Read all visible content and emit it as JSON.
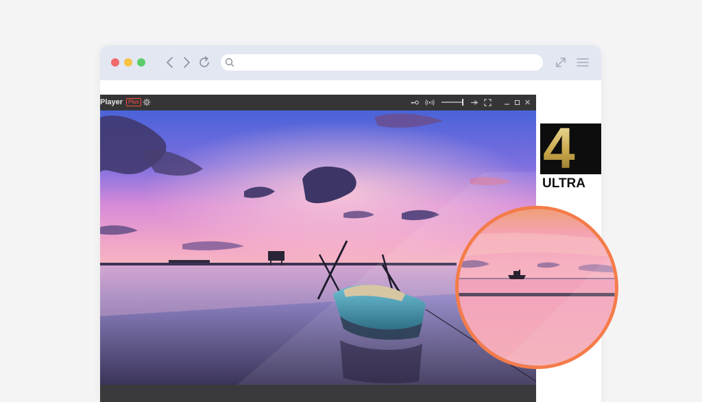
{
  "browser": {
    "window_controls": [
      "close",
      "minimize",
      "maximize"
    ],
    "nav_icons": [
      "back-icon",
      "forward-icon",
      "reload-icon"
    ],
    "search_icon": "search-icon",
    "address_value": "",
    "right_icons": [
      "expand-icon",
      "menu-icon"
    ]
  },
  "player": {
    "title": "Player",
    "badge": "Plus",
    "settings_icon": "gear-icon",
    "controls": [
      "key-icon",
      "broadcast-icon",
      "volume-slider",
      "pin-icon",
      "fullscreen-icon",
      "minimize-icon",
      "maximize-icon",
      "close-icon"
    ],
    "volume_level": 0.95
  },
  "logo": {
    "digit": "4",
    "text": "ULTRA"
  },
  "colors": {
    "accent": "#f47c4a",
    "badge_red": "#ff4b3a",
    "titlebar": "#e3e7f2"
  }
}
